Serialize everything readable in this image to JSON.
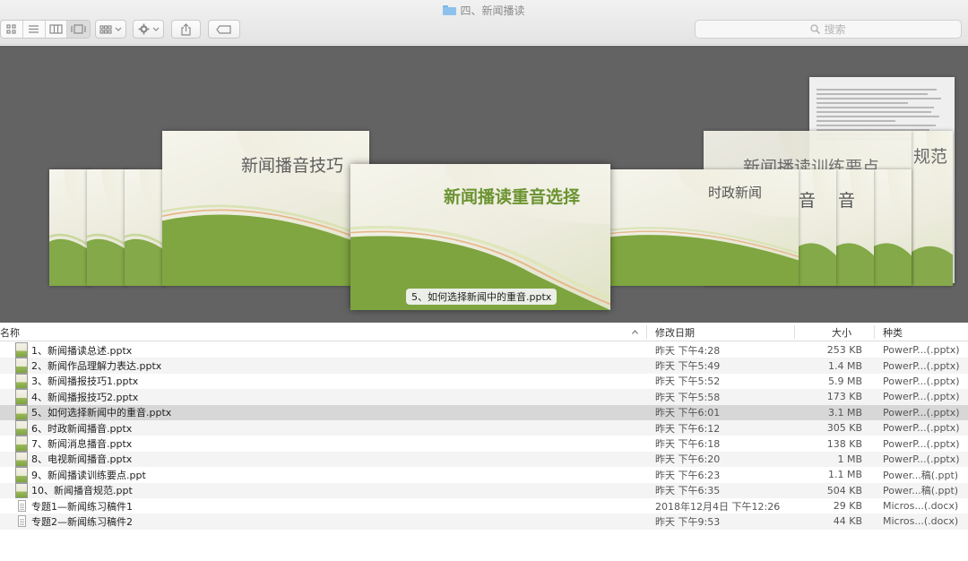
{
  "window": {
    "title": "四、新闻播读"
  },
  "toolbar": {
    "view_icons": [
      "icon-view-icon",
      "list-view-icon",
      "column-view-icon",
      "coverflow-view-icon"
    ],
    "search_placeholder": "搜索"
  },
  "coverflow": {
    "selected_caption": "5、如何选择新闻中的重音.pptx",
    "slides": [
      {
        "title": "新闻播音技巧"
      },
      {
        "title": "新闻播读重音选择"
      },
      {
        "title": "时政新闻"
      },
      {
        "title": "新闻播读训练要点"
      },
      {
        "title": "音"
      },
      {
        "title": "音"
      },
      {
        "title": "规范"
      }
    ]
  },
  "list": {
    "columns": {
      "name": "名称",
      "date": "修改日期",
      "size": "大小",
      "kind": "种类"
    },
    "files": [
      {
        "name": "1、新闻播读总述.pptx",
        "date": "昨天 下午4:28",
        "size": "253 KB",
        "kind": "PowerP...(.pptx)",
        "type": "ppt"
      },
      {
        "name": "2、新闻作品理解力表达.pptx",
        "date": "昨天 下午5:49",
        "size": "1.4 MB",
        "kind": "PowerP...(.pptx)",
        "type": "ppt"
      },
      {
        "name": "3、新闻播报技巧1.pptx",
        "date": "昨天 下午5:52",
        "size": "5.9 MB",
        "kind": "PowerP...(.pptx)",
        "type": "ppt"
      },
      {
        "name": "4、新闻播报技巧2.pptx",
        "date": "昨天 下午5:58",
        "size": "173 KB",
        "kind": "PowerP...(.pptx)",
        "type": "ppt"
      },
      {
        "name": "5、如何选择新闻中的重音.pptx",
        "date": "昨天 下午6:01",
        "size": "3.1 MB",
        "kind": "PowerP...(.pptx)",
        "type": "ppt",
        "selected": true
      },
      {
        "name": "6、时政新闻播音.pptx",
        "date": "昨天 下午6:12",
        "size": "305 KB",
        "kind": "PowerP...(.pptx)",
        "type": "ppt"
      },
      {
        "name": "7、新闻消息播音.pptx",
        "date": "昨天 下午6:18",
        "size": "138 KB",
        "kind": "PowerP...(.pptx)",
        "type": "ppt"
      },
      {
        "name": "8、电视新闻播音.pptx",
        "date": "昨天 下午6:20",
        "size": "1 MB",
        "kind": "PowerP...(.pptx)",
        "type": "ppt"
      },
      {
        "name": "9、新闻播读训练要点.ppt",
        "date": "昨天 下午6:23",
        "size": "1.1 MB",
        "kind": "Power...稿(.ppt)",
        "type": "ppt"
      },
      {
        "name": "10、新闻播音规范.ppt",
        "date": "昨天 下午6:35",
        "size": "504 KB",
        "kind": "Power...稿(.ppt)",
        "type": "ppt"
      },
      {
        "name": "专题1—新闻练习稿件1",
        "date": "2018年12月4日 下午12:26",
        "size": "29 KB",
        "kind": "Micros...(.docx)",
        "type": "doc"
      },
      {
        "name": "专题2—新闻练习稿件2",
        "date": "昨天 下午9:53",
        "size": "44 KB",
        "kind": "Micros...(.docx)",
        "type": "doc"
      }
    ]
  },
  "colors": {
    "coverflow_bg": "#636363",
    "slide_green": "#7da43f",
    "selected_row": "#d7d7d7"
  }
}
